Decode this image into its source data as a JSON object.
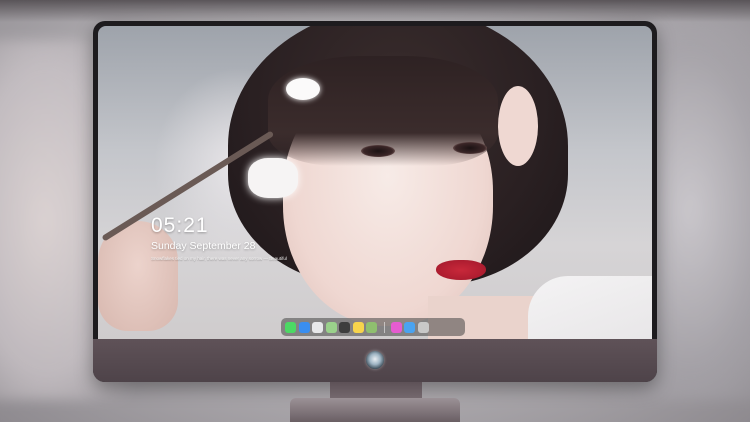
{
  "lock_screen": {
    "time": "05:21",
    "date": "Sunday September  28",
    "note": "Snowflakes tied on my hair, there was never any sorrow  —  Beautiful"
  },
  "dock": {
    "apps_left": [
      {
        "icon": "messages-icon",
        "color": "#4cd964"
      },
      {
        "icon": "finder-icon",
        "color": "#3a8ef0"
      },
      {
        "icon": "safari-icon",
        "color": "#e8e8ea"
      },
      {
        "icon": "maps-icon",
        "color": "#9ad18b"
      },
      {
        "icon": "clapper-icon",
        "color": "#3d3d3d"
      },
      {
        "icon": "notes-icon",
        "color": "#f7d44c"
      },
      {
        "icon": "photos-icon",
        "color": "#8fbf6f"
      }
    ],
    "apps_right": [
      {
        "icon": "itunes-icon",
        "color": "#e55cd0"
      },
      {
        "icon": "app-store-icon",
        "color": "#4aa3f0"
      },
      {
        "icon": "trash-icon",
        "color": "#c8c8c8"
      }
    ]
  },
  "colors": {
    "monitor_bezel": "#1d1b1e",
    "monitor_chin": "#5a4d53",
    "text": "#ffffff"
  }
}
